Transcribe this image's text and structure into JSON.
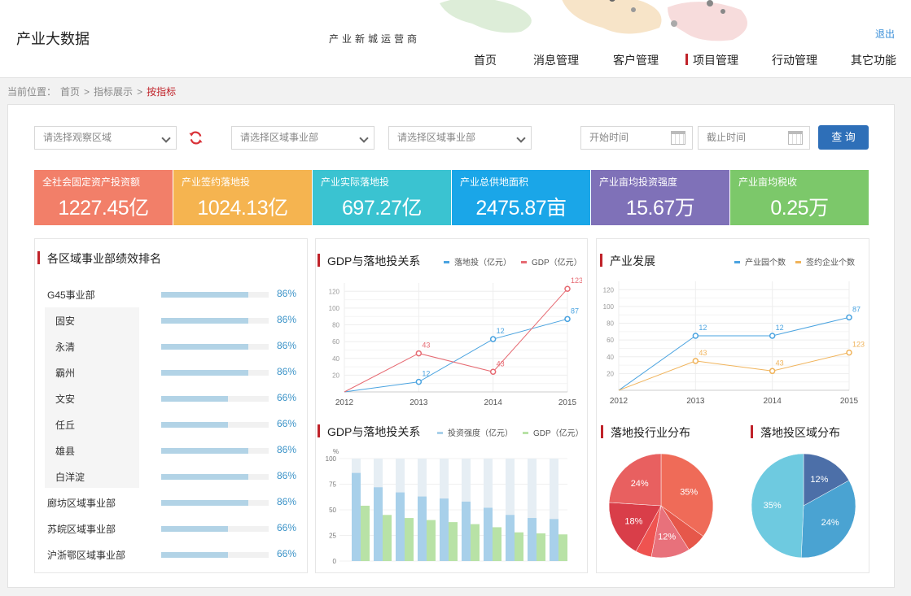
{
  "header": {
    "app_title": "产业大数据",
    "slogan": "产业新城运营商",
    "logout": "退出",
    "nav": [
      "首页",
      "消息管理",
      "客户管理",
      "项目管理",
      "行动管理",
      "其它功能"
    ],
    "active_nav": "项目管理"
  },
  "breadcrumb": {
    "prefix": "当前位置：",
    "home": "首页",
    "sep": ">",
    "mid": "指标展示",
    "current": "按指标"
  },
  "filters": {
    "area_placeholder": "请选择观察区域",
    "dept1_placeholder": "请选择区域事业部",
    "dept2_placeholder": "请选择区域事业部",
    "start_placeholder": "开始时间",
    "end_placeholder": "截止时间",
    "query_label": "查 询"
  },
  "kpis": [
    {
      "label": "全社会固定资产投资额",
      "value": "1227.45亿",
      "color": "#f27f69"
    },
    {
      "label": "产业签约落地投",
      "value": "1024.13亿",
      "color": "#f5b450"
    },
    {
      "label": "产业实际落地投",
      "value": "697.27亿",
      "color": "#3ac3d1"
    },
    {
      "label": "产业总供地面积",
      "value": "2475.87亩",
      "color": "#1aa6e8"
    },
    {
      "label": "产业亩均投资强度",
      "value": "15.67万",
      "color": "#7f71b8"
    },
    {
      "label": "产业亩均税收",
      "value": "0.25万",
      "color": "#7cc86a"
    }
  ],
  "ranking": {
    "title": "各区域事业部绩效排名",
    "rows": [
      {
        "name": "G45事业部",
        "pct_label": "86%",
        "value": 0.86,
        "sub": false
      },
      {
        "name": "固安",
        "pct_label": "86%",
        "value": 0.86,
        "sub": true
      },
      {
        "name": "永清",
        "pct_label": "86%",
        "value": 0.86,
        "sub": true
      },
      {
        "name": "霸州",
        "pct_label": "86%",
        "value": 0.86,
        "sub": true
      },
      {
        "name": "文安",
        "pct_label": "66%",
        "value": 0.66,
        "sub": true
      },
      {
        "name": "任丘",
        "pct_label": "66%",
        "value": 0.66,
        "sub": true
      },
      {
        "name": "雄县",
        "pct_label": "86%",
        "value": 0.86,
        "sub": true
      },
      {
        "name": "白洋淀",
        "pct_label": "86%",
        "value": 0.86,
        "sub": true
      },
      {
        "name": "廊坊区域事业部",
        "pct_label": "86%",
        "value": 0.86,
        "sub": false
      },
      {
        "name": "苏皖区域事业部",
        "pct_label": "66%",
        "value": 0.66,
        "sub": false
      },
      {
        "name": "沪浙鄂区域事业部",
        "pct_label": "66%",
        "value": 0.66,
        "sub": false
      }
    ]
  },
  "chart_data": [
    {
      "id": "gdp-line",
      "type": "line",
      "title": "GDP与落地投关系",
      "x": [
        "2012",
        "2013",
        "2014",
        "2015"
      ],
      "ylim": [
        0,
        130
      ],
      "yticks": [
        20,
        40,
        60,
        80,
        100,
        120
      ],
      "series": [
        {
          "name": "落地投（亿元）",
          "color": "#4aa3e0",
          "values": [
            0,
            12,
            63,
            87
          ],
          "labels": [
            "",
            "12",
            "12",
            "87"
          ]
        },
        {
          "name": "GDP（亿元）",
          "color": "#e66a72",
          "values": [
            0,
            46,
            24,
            123
          ],
          "labels": [
            "",
            "43",
            "43",
            "123"
          ]
        }
      ]
    },
    {
      "id": "dev-line",
      "type": "line",
      "title": "产业发展",
      "x": [
        "2012",
        "2013",
        "2014",
        "2015"
      ],
      "ylim": [
        0,
        130
      ],
      "yticks": [
        20,
        40,
        60,
        80,
        100,
        120
      ],
      "series": [
        {
          "name": "产业园个数",
          "color": "#4aa3e0",
          "values": [
            0,
            65,
            65,
            87
          ],
          "labels": [
            "",
            "12",
            "12",
            "87"
          ]
        },
        {
          "name": "签约企业个数",
          "color": "#f0b35a",
          "values": [
            0,
            35,
            23,
            45
          ],
          "labels": [
            "",
            "43",
            "43",
            "123"
          ]
        }
      ]
    },
    {
      "id": "gdp-bar",
      "type": "bar",
      "title": "GDP与落地投关系",
      "unit": "%",
      "ylim": [
        0,
        100
      ],
      "yticks": [
        0,
        25,
        50,
        75,
        100
      ],
      "series": [
        {
          "name": "投资强度（亿元）",
          "color": "#a8d0ea",
          "values": [
            86,
            72,
            67,
            63,
            61,
            58,
            52,
            45,
            42,
            41
          ]
        },
        {
          "name": "GDP（亿元）",
          "color": "#b8e2a6",
          "values": [
            54,
            45,
            42,
            40,
            38,
            36,
            33,
            28,
            27,
            26
          ]
        }
      ]
    },
    {
      "id": "industry-pie",
      "type": "pie",
      "title": "落地投行业分布",
      "slices": [
        {
          "value": 35,
          "label": "35%",
          "color": "#ef6b58"
        },
        {
          "value": 6,
          "label": "",
          "color": "#e6574a"
        },
        {
          "value": 12,
          "label": "12%",
          "color": "#e8717b"
        },
        {
          "value": 5,
          "label": "",
          "color": "#ef5350"
        },
        {
          "value": 18,
          "label": "18%",
          "color": "#d93e49"
        },
        {
          "value": 24,
          "label": "24%",
          "color": "#e86060"
        }
      ]
    },
    {
      "id": "region-pie",
      "type": "pie",
      "title": "落地投区域分布",
      "slices": [
        {
          "value": 12,
          "label": "12%",
          "color": "#4c6fa8"
        },
        {
          "value": 24,
          "label": "24%",
          "color": "#4aa3d2"
        },
        {
          "value": 35,
          "label": "35%",
          "color": "#6ecae0"
        }
      ]
    }
  ]
}
